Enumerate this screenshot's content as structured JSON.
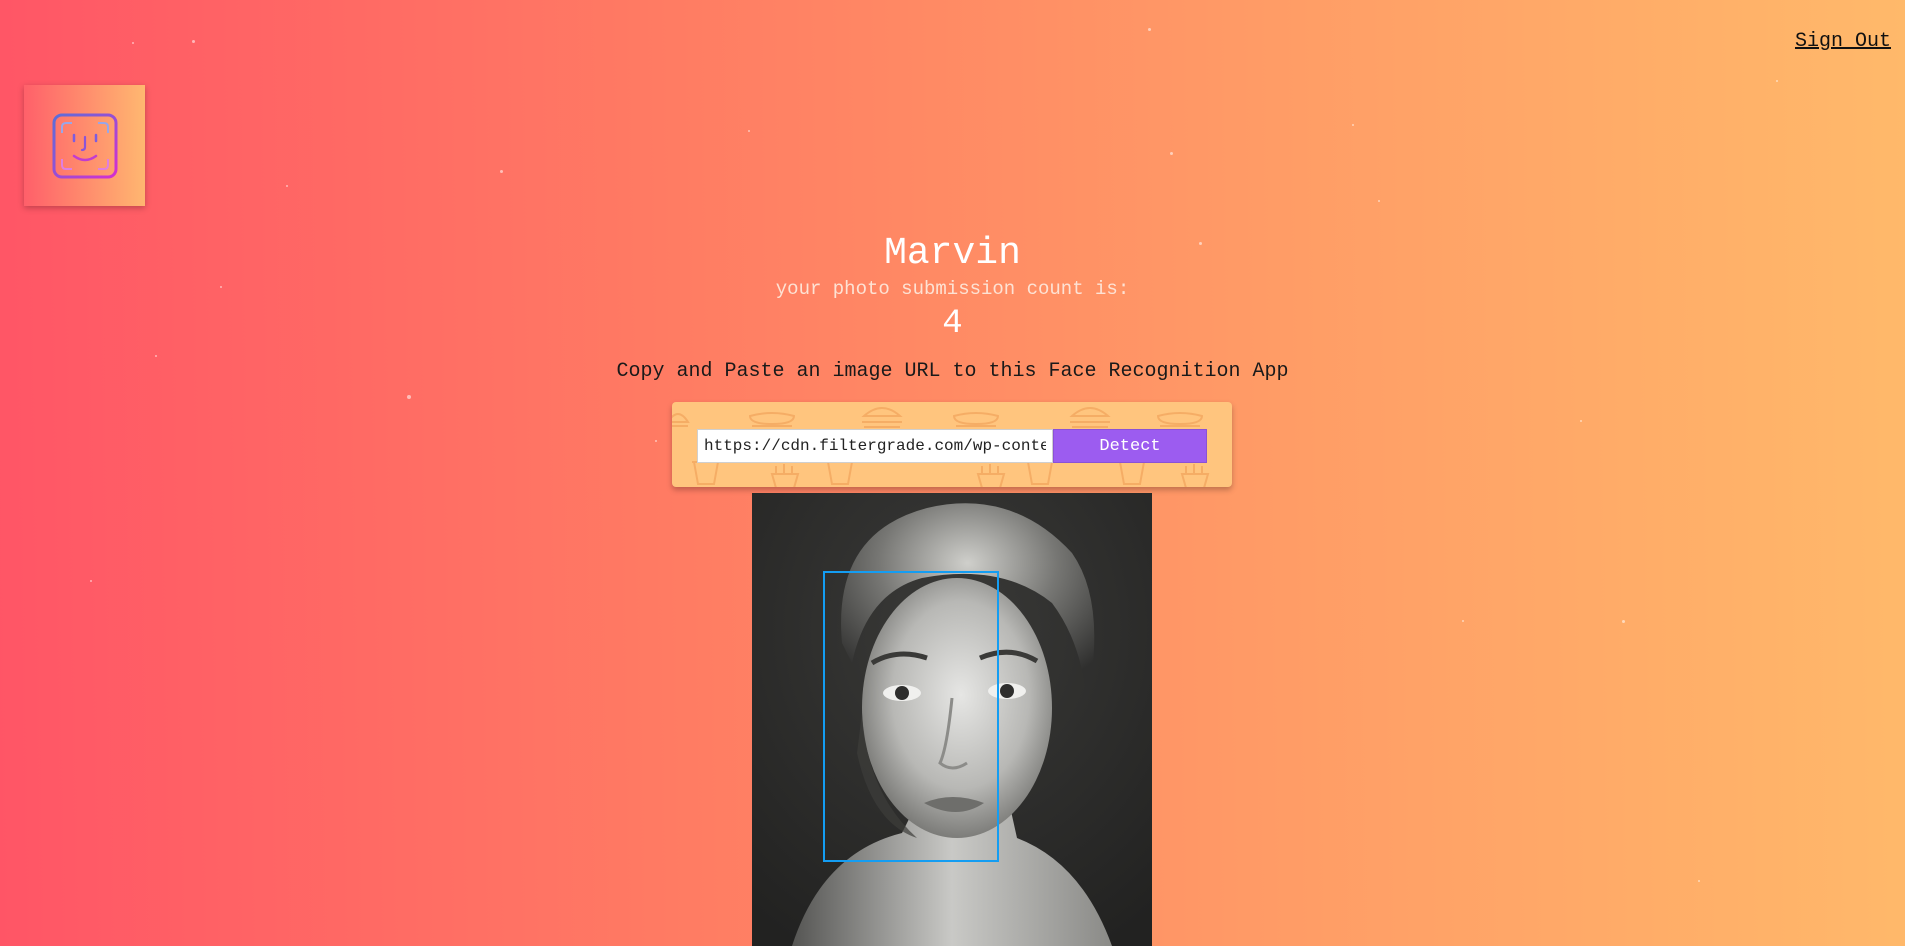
{
  "nav": {
    "signout_label": "Sign Out"
  },
  "logo": {
    "icon": "face-id-icon"
  },
  "rank": {
    "name": "Marvin",
    "label": "your photo submission count is:",
    "count": "4"
  },
  "instructions": "Copy and Paste an image URL to this Face Recognition App",
  "form": {
    "url_value": "https://cdn.filtergrade.com/wp-conte",
    "detect_label": "Detect"
  },
  "result": {
    "image_description_icon": "portrait-photo",
    "box_color": "#149df2"
  },
  "colors": {
    "gradient_start": "#ff5566",
    "gradient_end": "#ffb96a",
    "button": "#9c5cf0"
  }
}
